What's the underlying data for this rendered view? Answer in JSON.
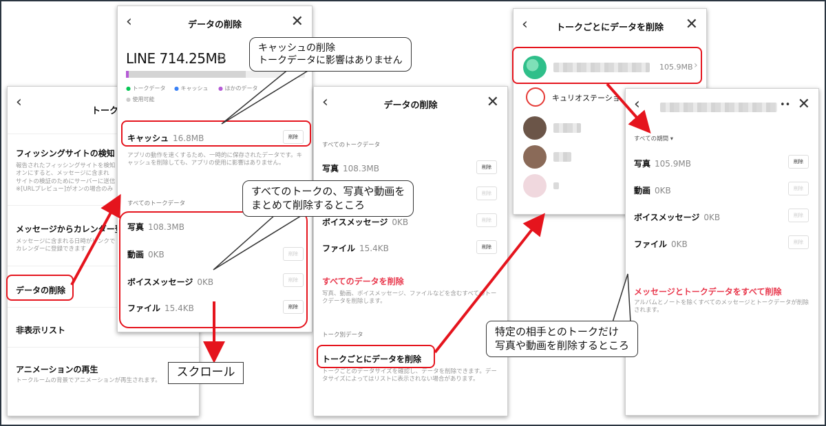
{
  "screen1": {
    "title": "トーク",
    "items": [
      {
        "title": "フィッシングサイトの検知",
        "desc": "報告されたフィッシングサイトを検知\nオンにすると、メッセージに含まれ\nサイトの検証のためにサーバーに送信\n※[URLプレビュー]がオンの場合のみ"
      },
      {
        "title": "メッセージからカレンダー登",
        "desc": "メッセージに含まれる日時がリンクで\nカレンダーに登録できます"
      },
      {
        "title": "データの削除",
        "desc": ""
      },
      {
        "title": "非表示リスト",
        "desc": ""
      },
      {
        "title": "アニメーションの再生",
        "desc": "トークルームの背景でアニメーションが再生されます。"
      }
    ]
  },
  "screen2": {
    "title": "データの削除",
    "total": "LINE 714.25MB",
    "legend": [
      "トークデータ",
      "キャッシュ",
      "ほかのデータ",
      "使用可能"
    ],
    "cache_label": "キャッシュ",
    "cache_size": "16.8MB",
    "cache_desc": "アプリの動作を速くするため、一時的に保存されたデータです。キャッシュを削除しても、アプリの使用に影響はありません。",
    "section": "すべてのトークデータ",
    "rows": [
      {
        "label": "写真",
        "size": "108.3MB"
      },
      {
        "label": "動画",
        "size": "0KB"
      },
      {
        "label": "ボイスメッセージ",
        "size": "0KB"
      },
      {
        "label": "ファイル",
        "size": "15.4KB"
      }
    ],
    "delete_label": "削除"
  },
  "screen3": {
    "title": "データの削除",
    "section": "すべてのトークデータ",
    "rows": [
      {
        "label": "写真",
        "size": "108.3MB"
      },
      {
        "label": "ボイスメッセージ",
        "size": "0KB"
      },
      {
        "label": "ファイル",
        "size": "15.4KB"
      }
    ],
    "delete_all": "すべてのデータを削除",
    "delete_all_desc": "写真、動画、ボイスメッセージ、ファイルなどを含むすべてのトークデータを削除します。",
    "section2": "トーク別データ",
    "per_talk": "トークごとにデータを削除",
    "per_talk_desc": "トークごとのデータサイズを確認し、データを削除できます。データサイズによってはリストに表示されない場合があります。"
  },
  "screen4": {
    "title": "トークごとにデータを削除",
    "first_size": "105.9MB",
    "second_name": "キュリオステーショ"
  },
  "screen5": {
    "period": "すべての期間",
    "rows": [
      {
        "label": "写真",
        "size": "105.9MB"
      },
      {
        "label": "動画",
        "size": "0KB"
      },
      {
        "label": "ボイスメッセージ",
        "size": "0KB"
      },
      {
        "label": "ファイル",
        "size": "0KB"
      }
    ],
    "delete_all": "メッセージとトークデータをすべて削除",
    "delete_all_desc": "アルバムとノートを除くすべてのメッセージとトークデータが削除されます。"
  },
  "annotations": {
    "cache_note": [
      "キャッシュの削除",
      "トークデータに影響はありません"
    ],
    "all_talks_note": [
      "すべてのトークの、写真や動画を",
      "まとめて削除するところ"
    ],
    "scroll_note": "スクロール",
    "per_talk_note": [
      "特定の相手とのトークだけ",
      "写真や動画を削除するところ"
    ]
  },
  "colors": {
    "highlight": "#e5141d",
    "accent_red": "#e8364b",
    "talk_data": "#06c755",
    "cache": "#3b82f6",
    "other": "#b55bd6"
  }
}
